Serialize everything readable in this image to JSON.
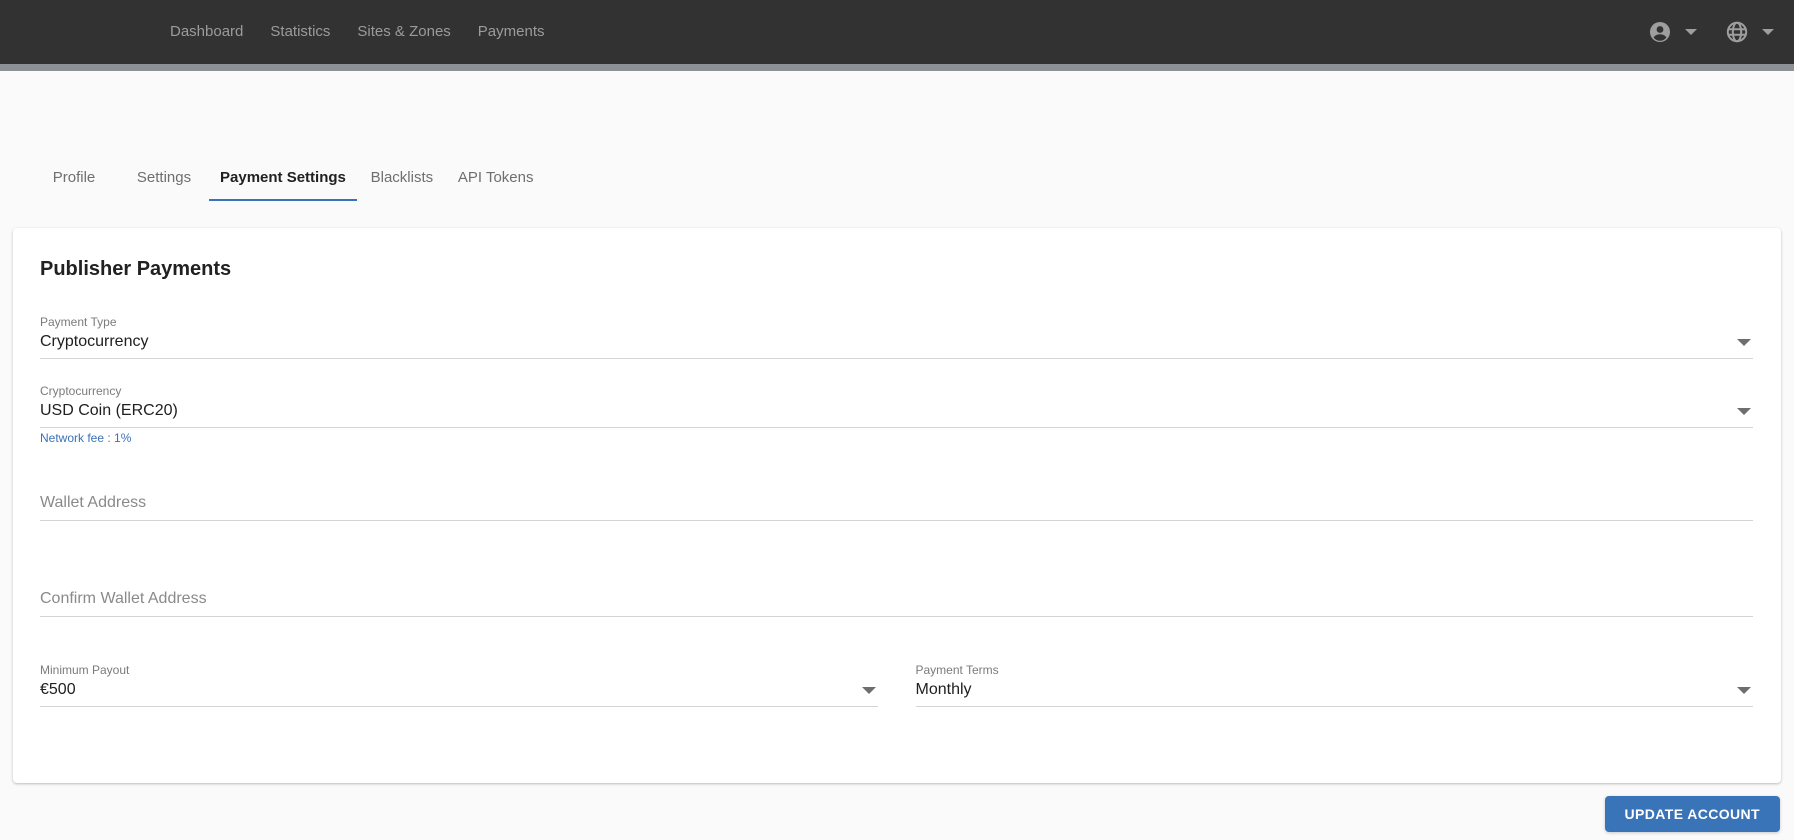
{
  "nav": {
    "items": [
      {
        "label": "Dashboard"
      },
      {
        "label": "Statistics"
      },
      {
        "label": "Sites & Zones"
      },
      {
        "label": "Payments"
      }
    ]
  },
  "tabs": [
    {
      "label": "Profile",
      "active": false
    },
    {
      "label": "Settings",
      "active": false
    },
    {
      "label": "Payment Settings",
      "active": true
    },
    {
      "label": "Blacklists",
      "active": false
    },
    {
      "label": "API Tokens",
      "active": false
    }
  ],
  "card": {
    "title": "Publisher Payments",
    "fields": {
      "payment_type": {
        "label": "Payment Type",
        "value": "Cryptocurrency"
      },
      "cryptocurrency": {
        "label": "Cryptocurrency",
        "value": "USD Coin (ERC20)",
        "helper": "Network fee : 1%"
      },
      "wallet_address": {
        "placeholder": "Wallet Address",
        "value": ""
      },
      "confirm_wallet_address": {
        "placeholder": "Confirm Wallet Address",
        "value": ""
      },
      "minimum_payout": {
        "label": "Minimum Payout",
        "value": "€500"
      },
      "payment_terms": {
        "label": "Payment Terms",
        "value": "Monthly"
      }
    }
  },
  "actions": {
    "update_button": "UPDATE ACCOUNT"
  },
  "icons": {
    "account": "account-circle-icon",
    "language": "globe-icon",
    "dropdown": "chevron-down-icon"
  },
  "colors": {
    "navbar_bg": "#323232",
    "nav_text": "#9b9b9b",
    "shadow_strip": "#8b9197",
    "page_bg": "#fafafa",
    "accent_blue": "#3a72b7",
    "button_blue": "#3a74b8",
    "link_blue": "#3a72b7",
    "field_underline": "#d4d4d4"
  }
}
